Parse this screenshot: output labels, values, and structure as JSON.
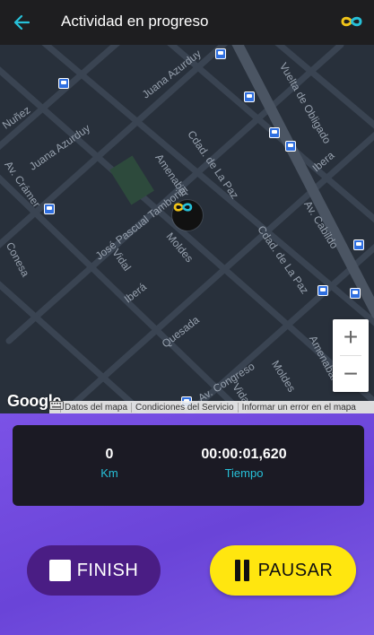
{
  "header": {
    "title": "Actividad en progreso",
    "back_icon": "arrow-left-icon",
    "brand_icon": "infinity-logo-icon"
  },
  "map": {
    "streets": [
      "Juana Azurduy",
      "Vuelta de Obligado",
      "Nuñez",
      "Juana Azurduy",
      "Av. Crámer",
      "Cdad. de La Paz",
      "Ibera",
      "Amenabar",
      "Av. Cabildo",
      "José Pascual Tamborini",
      "Moldes",
      "Conesa",
      "Vidal",
      "Cdad. de La Paz",
      "Iberá",
      "Quesada",
      "Amenabar",
      "Av. Congreso",
      "Vidal",
      "Moldes"
    ],
    "zoom_in": "+",
    "zoom_out": "−",
    "logo": "Google",
    "footer": {
      "keyboard_icon": "keyboard-icon",
      "map_data": "Datos del mapa",
      "terms": "Condiciones del Servicio",
      "report": "Informar un error en el mapa"
    }
  },
  "stats": {
    "distance_value": "0",
    "distance_label": "Km",
    "time_value": "00:00:01,620",
    "time_label": "Tiempo"
  },
  "actions": {
    "finish_label": "FINISH",
    "pause_label": "PAUSAR"
  },
  "colors": {
    "accent": "#27c0d8",
    "panel": "#7b52e6",
    "finish": "#4a1d84",
    "pause": "#ffe60f"
  }
}
